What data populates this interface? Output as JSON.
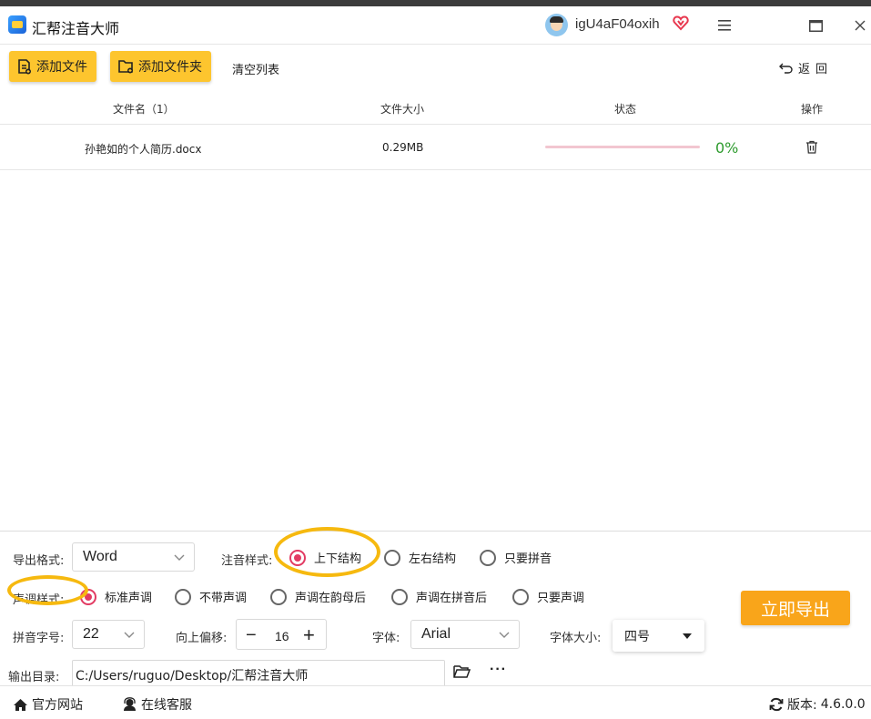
{
  "app": {
    "title": "汇帮注音大师",
    "username": "igU4aF04oxih"
  },
  "toolbar": {
    "add_file": "添加文件",
    "add_folder": "添加文件夹",
    "clear_list": "清空列表",
    "back": "返回"
  },
  "table": {
    "headers": {
      "name": "文件名（1）",
      "size": "文件大小",
      "status": "状态",
      "action": "操作"
    },
    "rows": [
      {
        "name": "孙艳如的个人简历.docx",
        "size": "0.29MB",
        "progress_text": "0%",
        "progress": 0
      }
    ]
  },
  "settings": {
    "export_format_label": "导出格式:",
    "export_format_value": "Word",
    "annotation_style_label": "注音样式:",
    "annotation_options": [
      "上下结构",
      "左右结构",
      "只要拼音"
    ],
    "annotation_selected": 0,
    "tone_style_label": "声调样式:",
    "tone_options": [
      "标准声调",
      "不带声调",
      "声调在韵母后",
      "声调在拼音后",
      "只要声调"
    ],
    "tone_selected": 0,
    "pinyin_size_label": "拼音字号:",
    "pinyin_size_value": "22",
    "offset_label": "向上偏移:",
    "offset_value": "16",
    "font_label": "字体:",
    "font_value": "Arial",
    "font_size_label": "字体大小:",
    "font_size_value": "四号",
    "output_dir_label": "输出目录:",
    "output_dir_value": "C:/Users/ruguo/Desktop/汇帮注音大师",
    "export_button": "立即导出"
  },
  "footer": {
    "website": "官方网站",
    "service": "在线客服",
    "version_label": "版本:",
    "version_value": "4.6.0.0"
  },
  "colors": {
    "accent_yellow": "#fdc52e",
    "export_orange": "#f9a51a",
    "radio_selected": "#e23b63",
    "progress_text": "#2e9b2e",
    "highlight_circle": "#f6b90f"
  }
}
